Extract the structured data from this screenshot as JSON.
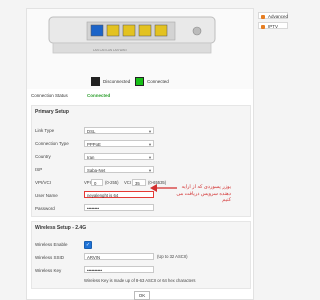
{
  "side_tabs": [
    {
      "label": "Advanced"
    },
    {
      "label": "IPTV"
    }
  ],
  "router": {
    "caption": "Tenda",
    "legend": [
      {
        "label": "Disconnected",
        "color": "#222222"
      },
      {
        "label": "Connected",
        "color": "#18c018"
      }
    ],
    "port_colors": [
      "#1c64c8",
      "#e3c220",
      "#e3c220",
      "#e3c220",
      "#e3c220"
    ]
  },
  "status": {
    "label": "Connection Status",
    "value": "Connected",
    "value_color": "#2a9d2a"
  },
  "primary": {
    "title": "Primary Setup",
    "link_type": {
      "label": "Link Type",
      "value": "DSL"
    },
    "connection_type": {
      "label": "Connection Type",
      "value": "PPPoE"
    },
    "country": {
      "label": "Country",
      "value": "Iran"
    },
    "isp": {
      "label": "ISP",
      "value": "Saba-Net"
    },
    "vpivci": {
      "label": "VPI/VCI",
      "vpi_label": "VPI",
      "vpi": "0",
      "vpi_range": "(0-255)",
      "vci_label": "VCI",
      "vci": "35",
      "vci_range": "(0-65535)"
    },
    "username": {
      "label": "User Name",
      "value": "neyalenght is 64"
    },
    "password": {
      "label": "Password",
      "value": "••••••••"
    }
  },
  "annotation": {
    "text": "یوزر پسوردی که از ارایه دهنده سرویس دریافت می کنیم",
    "color": "#d32f2f"
  },
  "wireless": {
    "title": "Wireless Setup - 2.4G",
    "enable": {
      "label": "Wireless Enable",
      "checked": true
    },
    "ssid": {
      "label": "Wireless SSID",
      "value": "ARVIN",
      "hint": "(Up to 32 ASCII)"
    },
    "key": {
      "label": "Wireless Key",
      "value": "••••••••••",
      "hint": "Wireless Key is made up of 8-63 ASCII or 64 hex characters"
    }
  },
  "ok_label": "OK"
}
